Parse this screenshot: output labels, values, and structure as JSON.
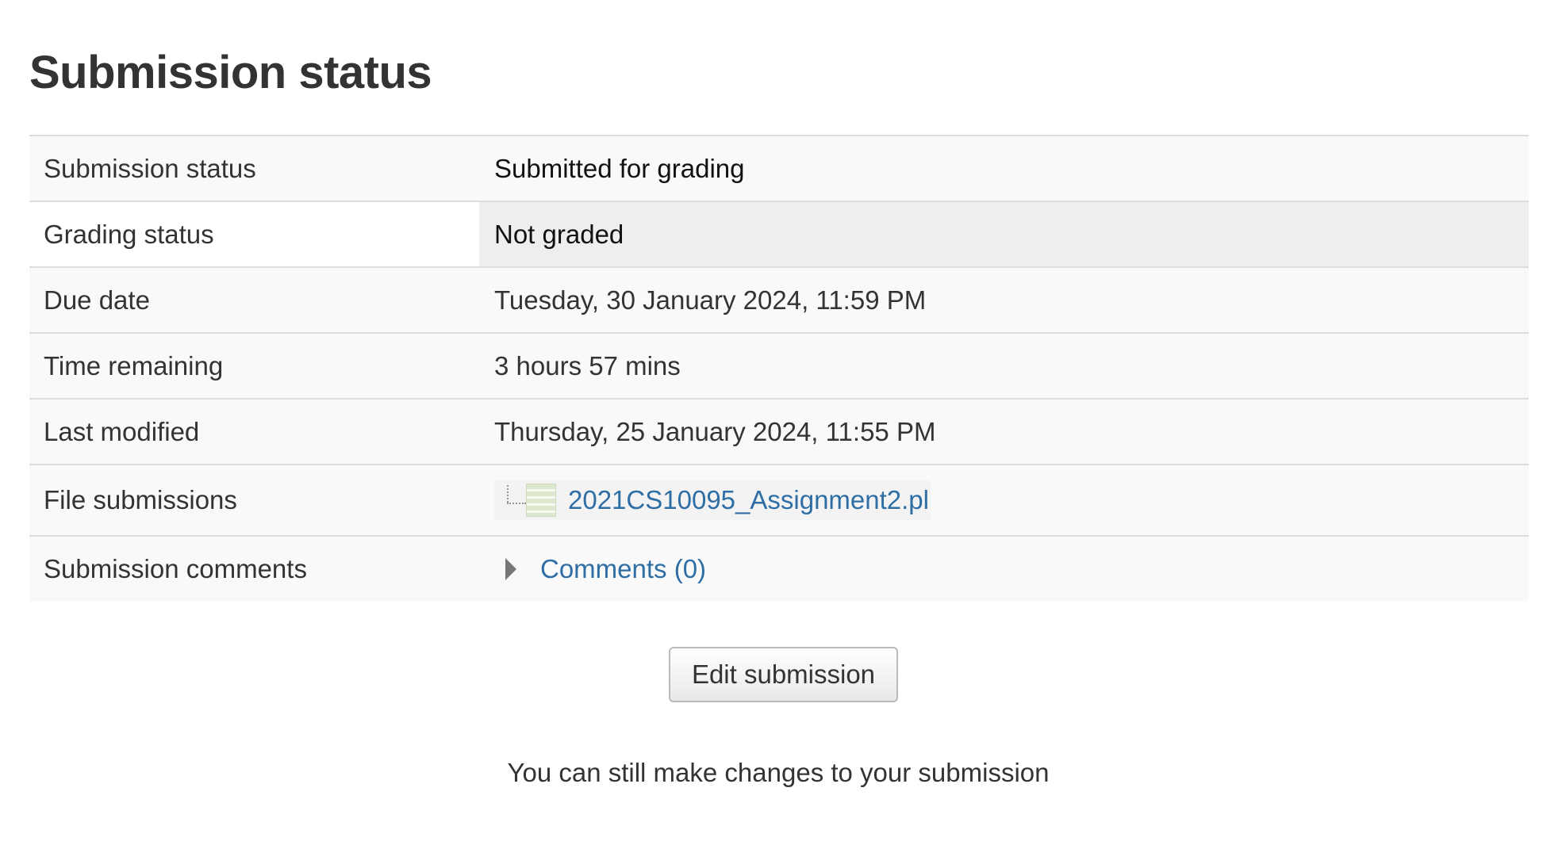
{
  "page": {
    "title": "Submission status"
  },
  "status_table": {
    "rows": [
      {
        "label": "Submission status",
        "value": "Submitted for grading"
      },
      {
        "label": "Grading status",
        "value": "Not graded"
      },
      {
        "label": "Due date",
        "value": "Tuesday, 30 January 2024, 11:59 PM"
      },
      {
        "label": "Time remaining",
        "value": "3 hours 57 mins"
      },
      {
        "label": "Last modified",
        "value": "Thursday, 25 January 2024, 11:55 PM"
      },
      {
        "label": "File submissions",
        "file_name": "2021CS10095_Assignment2.pl",
        "file_icon": "document-icon"
      },
      {
        "label": "Submission comments",
        "comments_link": "Comments (0)",
        "toggle_icon": "caret-right-icon"
      }
    ]
  },
  "actions": {
    "edit_submission_label": "Edit submission",
    "note": "You can still make changes to your submission"
  },
  "colors": {
    "link": "#2f6ea5",
    "row_background": "#f9f9f9",
    "highlight_cell": "#eeeeee",
    "border": "#dddddd"
  }
}
